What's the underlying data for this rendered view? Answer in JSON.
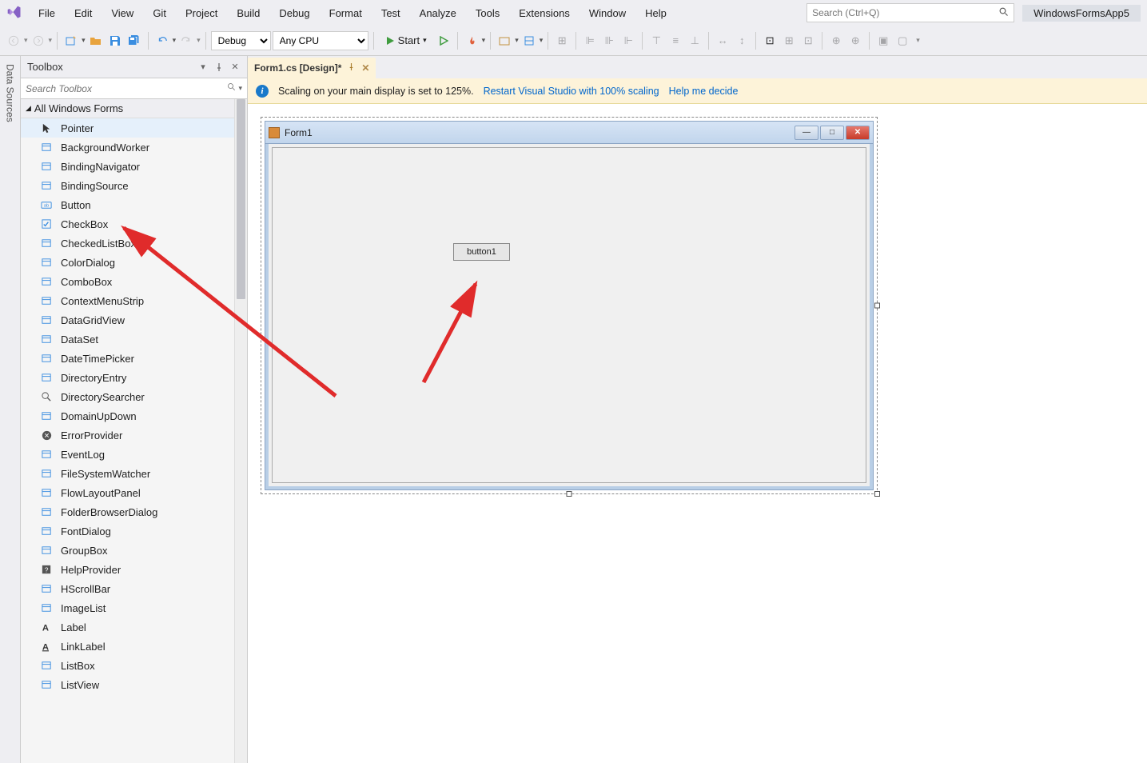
{
  "menubar": {
    "items": [
      "File",
      "Edit",
      "View",
      "Git",
      "Project",
      "Build",
      "Debug",
      "Format",
      "Test",
      "Analyze",
      "Tools",
      "Extensions",
      "Window",
      "Help"
    ],
    "search_placeholder": "Search (Ctrl+Q)",
    "project_name": "WindowsFormsApp5"
  },
  "toolbar": {
    "config": "Debug",
    "platform": "Any CPU",
    "start_label": "Start"
  },
  "vtab": {
    "label": "Data Sources"
  },
  "toolbox": {
    "title": "Toolbox",
    "search_placeholder": "Search Toolbox",
    "category": "All Windows Forms",
    "items": [
      {
        "label": "Pointer",
        "selected": true
      },
      {
        "label": "BackgroundWorker"
      },
      {
        "label": "BindingNavigator"
      },
      {
        "label": "BindingSource"
      },
      {
        "label": "Button"
      },
      {
        "label": "CheckBox"
      },
      {
        "label": "CheckedListBox"
      },
      {
        "label": "ColorDialog"
      },
      {
        "label": "ComboBox"
      },
      {
        "label": "ContextMenuStrip"
      },
      {
        "label": "DataGridView"
      },
      {
        "label": "DataSet"
      },
      {
        "label": "DateTimePicker"
      },
      {
        "label": "DirectoryEntry"
      },
      {
        "label": "DirectorySearcher"
      },
      {
        "label": "DomainUpDown"
      },
      {
        "label": "ErrorProvider"
      },
      {
        "label": "EventLog"
      },
      {
        "label": "FileSystemWatcher"
      },
      {
        "label": "FlowLayoutPanel"
      },
      {
        "label": "FolderBrowserDialog"
      },
      {
        "label": "FontDialog"
      },
      {
        "label": "GroupBox"
      },
      {
        "label": "HelpProvider"
      },
      {
        "label": "HScrollBar"
      },
      {
        "label": "ImageList"
      },
      {
        "label": "Label"
      },
      {
        "label": "LinkLabel"
      },
      {
        "label": "ListBox"
      },
      {
        "label": "ListView"
      }
    ]
  },
  "document": {
    "tab_title": "Form1.cs [Design]*",
    "info_text": "Scaling on your main display is set to 125%.",
    "info_link1": "Restart Visual Studio with 100% scaling",
    "info_link2": "Help me decide"
  },
  "winform": {
    "title": "Form1",
    "button_text": "button1"
  }
}
